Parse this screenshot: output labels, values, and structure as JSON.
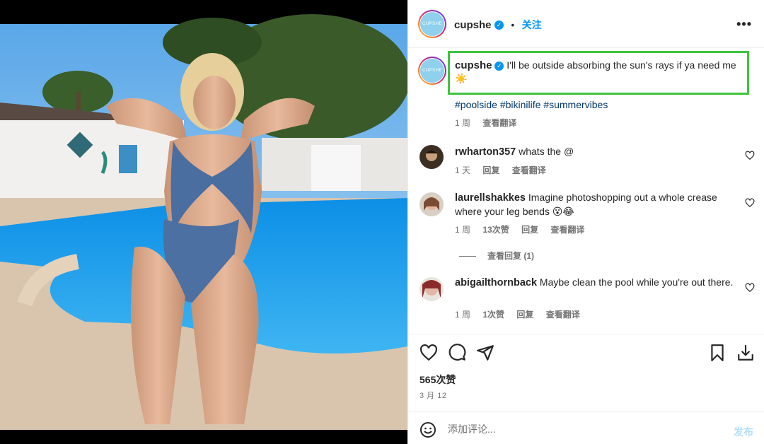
{
  "post": {
    "username": "cupshe",
    "avatar_text": "CUPSHE",
    "follow_label": "关注",
    "separator": "•",
    "more_label": "•••",
    "caption": "I'll be outside absorbing the sun's rays if ya need me ☀️",
    "hashtags": "#poolside #bikinilife #summervibes",
    "caption_time": "1 周",
    "see_translation": "查看翻译"
  },
  "comments": [
    {
      "username": "rwharton357",
      "text": "whats the @",
      "time": "1 天",
      "likes": "",
      "reply_label": "回复",
      "translate_label": "查看翻译"
    },
    {
      "username": "laurellshakkes",
      "text": "Imagine photoshopping out a whole crease where your leg bends 😮😂",
      "time": "1 周",
      "likes": "13次赞",
      "reply_label": "回复",
      "translate_label": "查看翻译",
      "view_replies": "查看回复 (1)"
    },
    {
      "username": "abigailthornback",
      "text": "Maybe clean the pool while you're out there.",
      "time": "1 周",
      "likes": "1次赞",
      "reply_label": "回复",
      "translate_label": "查看翻译"
    }
  ],
  "actions": {
    "like_count": "565次赞",
    "date": "3 月 12",
    "icons": [
      "heart-icon",
      "comment-icon",
      "share-icon",
      "bookmark-icon",
      "download-icon"
    ]
  },
  "composer": {
    "placeholder": "添加评论...",
    "post_label": "发布"
  },
  "colors": {
    "accent": "#0095f6",
    "highlight_box": "#3fc43f",
    "hashtag": "#00376b",
    "muted": "#737373"
  }
}
